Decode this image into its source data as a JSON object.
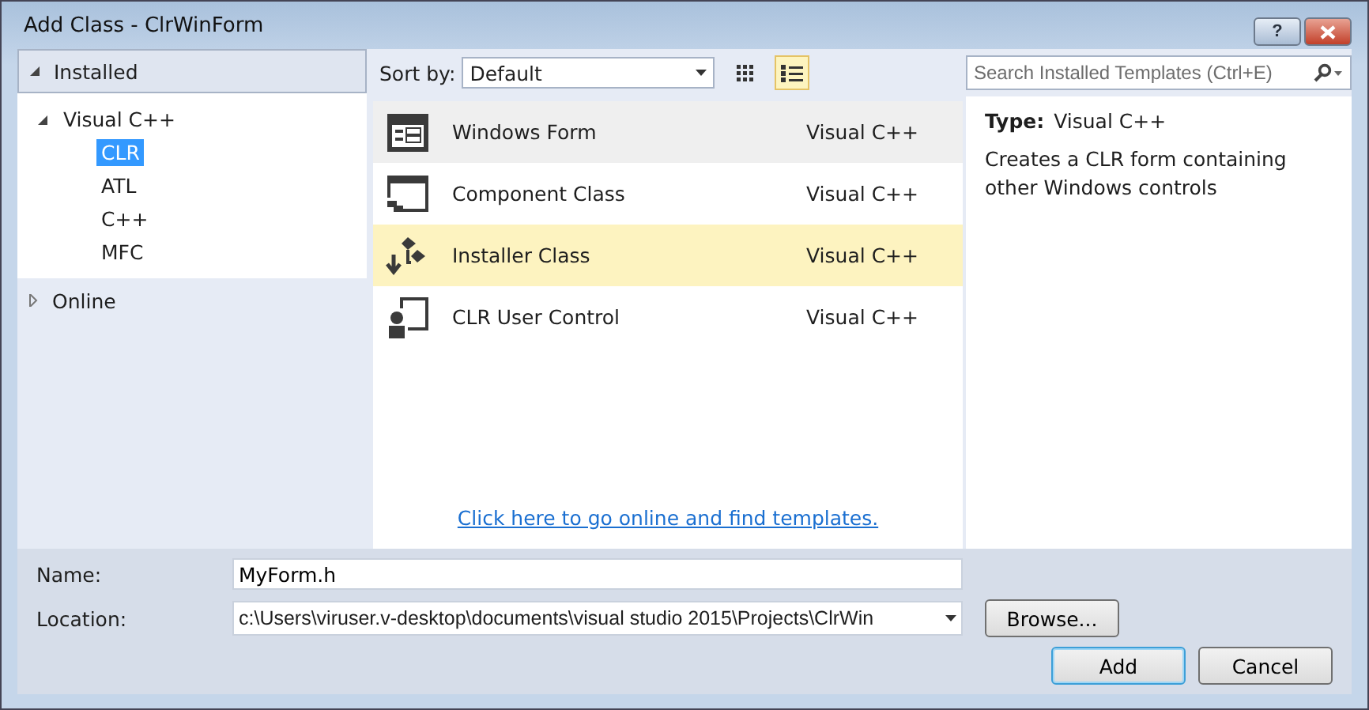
{
  "window": {
    "title": "Add Class - ClrWinForm",
    "help": "?"
  },
  "sidebar": {
    "sections": [
      {
        "label": "Installed",
        "expanded": true,
        "children": [
          {
            "label": "Visual C++",
            "expanded": true,
            "selected": false,
            "children": [
              {
                "label": "CLR",
                "selected": true
              },
              {
                "label": "ATL",
                "selected": false
              },
              {
                "label": "C++",
                "selected": false
              },
              {
                "label": "MFC",
                "selected": false
              }
            ]
          }
        ]
      },
      {
        "label": "Online",
        "expanded": false
      }
    ]
  },
  "toolbar": {
    "sort_label": "Sort by:",
    "sort_value": "Default",
    "views": [
      {
        "kind": "grid",
        "selected": false
      },
      {
        "kind": "list",
        "selected": true
      }
    ],
    "search": {
      "placeholder": "Search Installed Templates (Ctrl+E)"
    }
  },
  "templates": [
    {
      "name": "Windows Form",
      "type": "Visual C++",
      "kind": "form",
      "selected": true,
      "hovered": false
    },
    {
      "name": "Component Class",
      "type": "Visual C++",
      "kind": "component",
      "selected": false,
      "hovered": false
    },
    {
      "name": "Installer Class",
      "type": "Visual C++",
      "kind": "installer",
      "selected": false,
      "hovered": true
    },
    {
      "name": "CLR User Control",
      "type": "Visual C++",
      "kind": "usercontrol",
      "selected": false,
      "hovered": false
    }
  ],
  "online_link": "Click here to go online and find templates.",
  "details": {
    "type_label": "Type:",
    "type_value": "Visual C++",
    "description": "Creates a CLR form containing other Windows controls"
  },
  "form": {
    "name_label": "Name:",
    "name_value": "MyForm.h",
    "location_label": "Location:",
    "location_value": "c:\\Users\\viruser.v-desktop\\documents\\visual studio 2015\\Projects\\ClrWin",
    "browse": "Browse..."
  },
  "buttons": [
    {
      "label": "Add",
      "default": true
    },
    {
      "label": "Cancel",
      "default": false
    }
  ]
}
